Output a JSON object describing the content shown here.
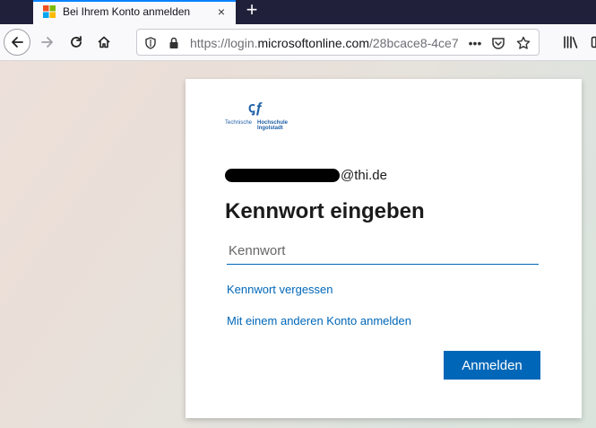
{
  "browser": {
    "tab": {
      "title": "Bei Ihrem Konto anmelden",
      "favicon": "microsoft-logo-icon",
      "close": "×"
    },
    "new_tab": "+",
    "toolbar": {
      "back": "back-arrow-icon",
      "forward": "forward-arrow-icon",
      "reload": "reload-icon",
      "home": "home-icon",
      "library": "library-icon",
      "sidebar": "sidebar-icon"
    },
    "urlbar": {
      "scheme": "https://login.",
      "domain": "microsoftonline.com",
      "path": "/28bcace8-4ce7",
      "page_actions": "•••",
      "icons": [
        "shield-icon",
        "lock-icon",
        "pocket-icon",
        "star-icon"
      ]
    }
  },
  "login": {
    "logo": {
      "mark": "ꞔƒ",
      "left_text": "Technische",
      "right_line1": "Hochschule",
      "right_line2": "Ingolstadt"
    },
    "email_suffix": "@thi.de",
    "heading": "Kennwort eingeben",
    "password_placeholder": "Kennwort",
    "forgot_link": "Kennwort vergessen",
    "other_account_link": "Mit einem anderen Konto anmelden",
    "submit_label": "Anmelden"
  },
  "colors": {
    "accent": "#0067b8",
    "tab_highlight": "#0a84ff",
    "tabbar_bg": "#20203a"
  }
}
